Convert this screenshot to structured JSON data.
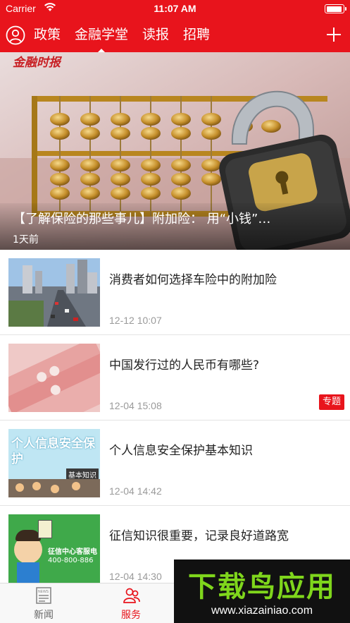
{
  "status_bar": {
    "carrier": "Carrier",
    "time": "11:07 AM"
  },
  "nav": {
    "tabs": [
      {
        "label": "政策",
        "active": false
      },
      {
        "label": "金融学堂",
        "active": true
      },
      {
        "label": "读报",
        "active": false
      },
      {
        "label": "招聘",
        "active": false
      }
    ],
    "accent_color": "#e8141c"
  },
  "hero": {
    "logo_text": "金融时报",
    "title": "【了解保险的那些事儿】附加险： 用“小钱”…",
    "time": "1天前"
  },
  "articles": [
    {
      "title": "消费者如何选择车险中的附加险",
      "time": "12-12 10:07",
      "badge": "",
      "thumb": "city-traffic"
    },
    {
      "title": "中国发行过的人民币有哪些?",
      "time": "12-04 15:08",
      "badge": "专题",
      "thumb": "banknotes"
    },
    {
      "title": "个人信息安全保护基本知识",
      "time": "12-04 14:42",
      "badge": "",
      "thumb": "info-security-poster",
      "thumb_text": "个人信息安全保护",
      "thumb_subtext": "基本知识"
    },
    {
      "title": "征信知识很重要，记录良好道路宽",
      "time": "12-04 14:30",
      "badge": "",
      "thumb": "credit-cartoon",
      "thumb_text": "征信中心客服电",
      "thumb_subtext": "400-800-886"
    }
  ],
  "tabbar": {
    "items": [
      {
        "label": "新闻",
        "icon": "news-icon",
        "active": false
      },
      {
        "label": "服务",
        "icon": "service-icon",
        "active": true
      }
    ]
  },
  "watermark": {
    "title": "下载鸟应用",
    "url": "www.xiazainiao.com"
  }
}
